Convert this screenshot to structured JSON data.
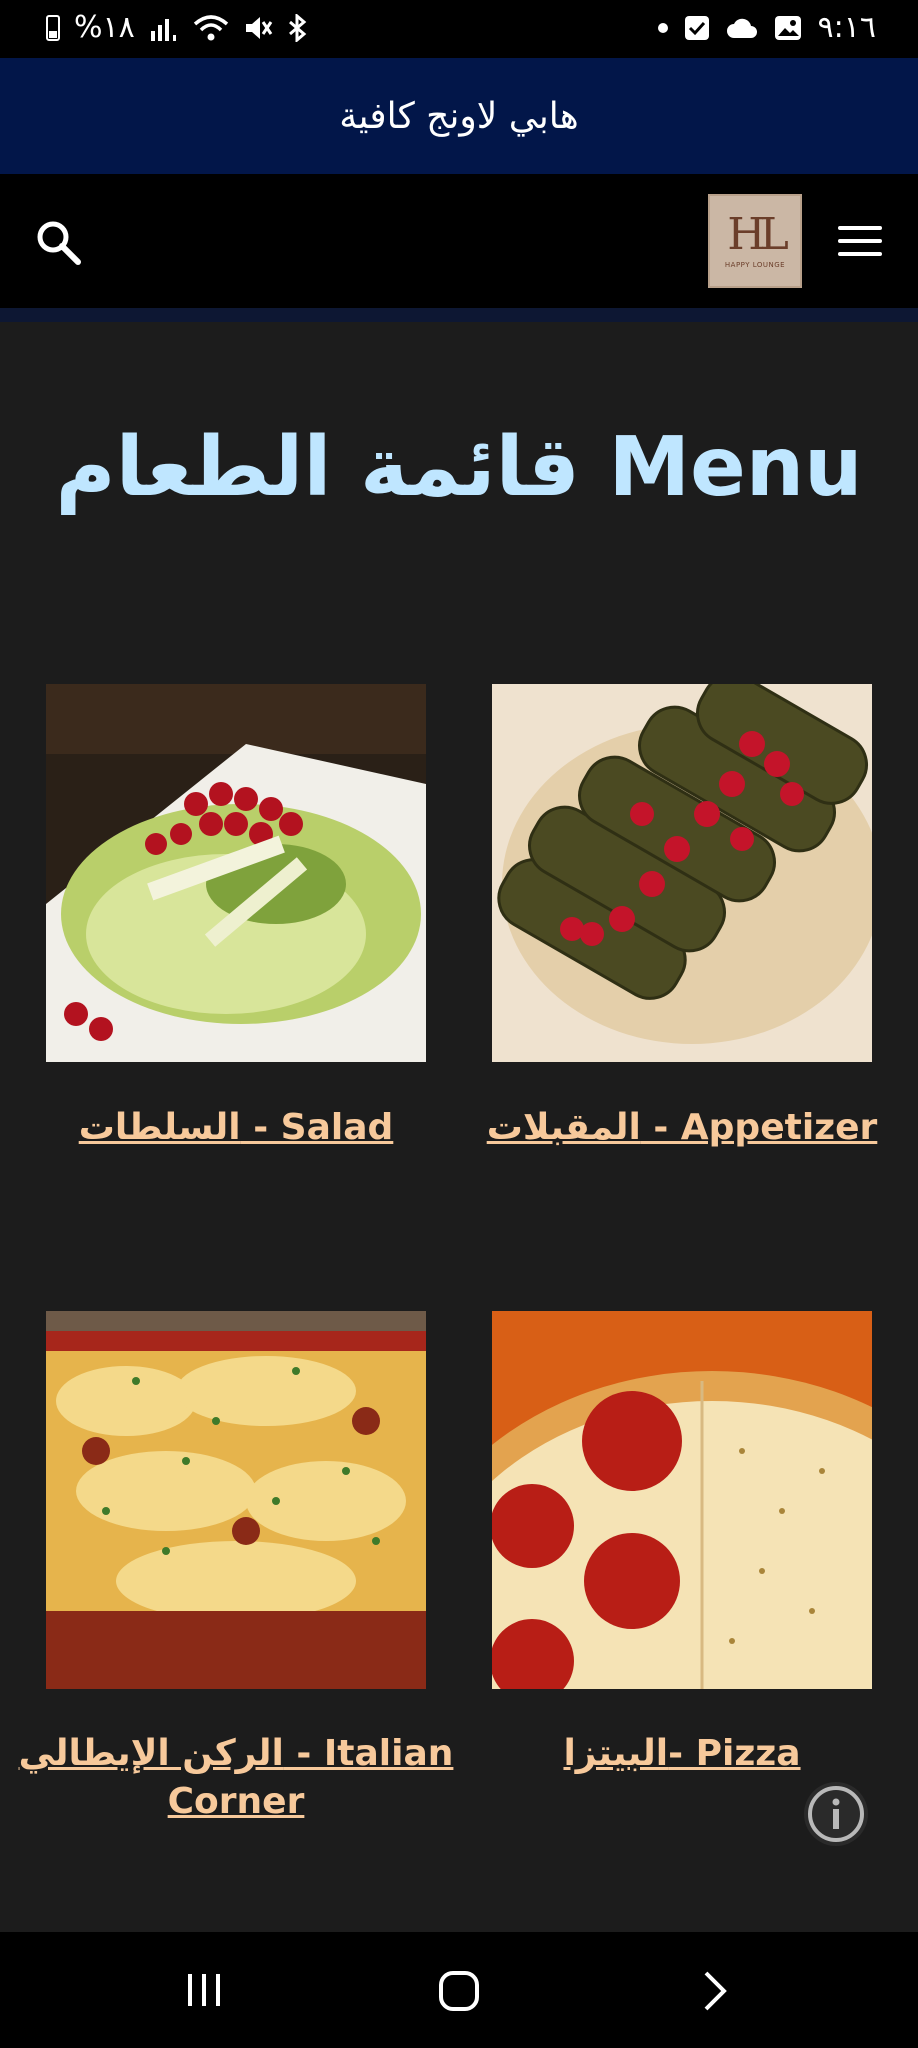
{
  "status_bar": {
    "battery": "%١٨",
    "time": "٩:١٦"
  },
  "banner": {
    "title": "هابي لاونج كافية"
  },
  "header": {
    "logo_text": "HL",
    "logo_subtext": "HAPPY LOUNGE"
  },
  "page": {
    "title": "قائمة الطعام Menu"
  },
  "categories": [
    {
      "label": "السلطات - Salad",
      "image": "salad with pomegranate"
    },
    {
      "label": "المقبلات - Appetizer",
      "image": "stuffed grape leaves with pomegranate"
    },
    {
      "label": "الركن الإيطالي - Italian Corner",
      "image": "lasagna"
    },
    {
      "label": "البيتزا- Pizza",
      "image": "pepperoni pizza"
    }
  ],
  "colors": {
    "banner": "#021649",
    "title": "#bfe6ff",
    "link": "#f7c99b",
    "background": "#1c1c1c"
  }
}
